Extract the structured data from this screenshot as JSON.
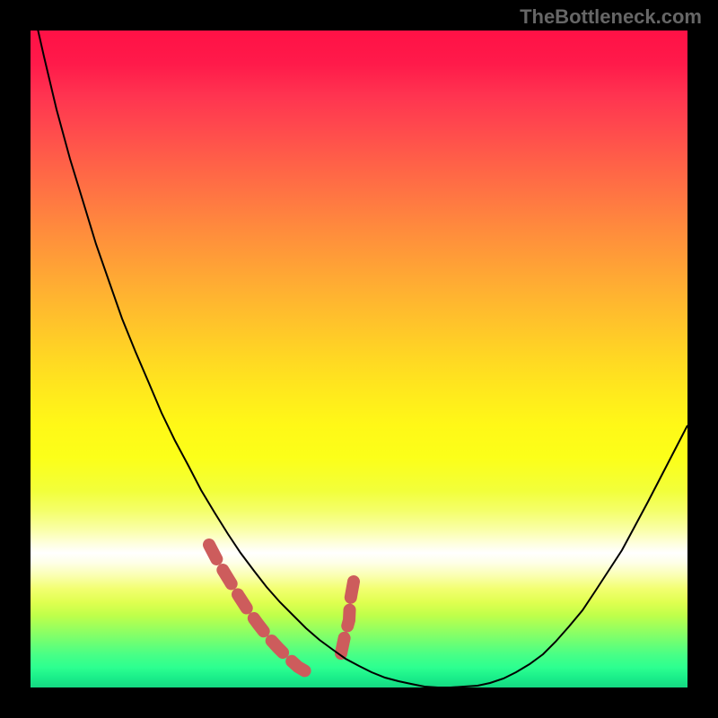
{
  "watermark": "TheBottleneck.com",
  "chart_data": {
    "type": "line",
    "title": "",
    "xlabel": "",
    "ylabel": "",
    "x": [
      0.0,
      0.02,
      0.04,
      0.06,
      0.08,
      0.1,
      0.12,
      0.14,
      0.16,
      0.18,
      0.2,
      0.22,
      0.24,
      0.26,
      0.28,
      0.3,
      0.32,
      0.34,
      0.36,
      0.38,
      0.4,
      0.42,
      0.44,
      0.46,
      0.48,
      0.5,
      0.52,
      0.54,
      0.56,
      0.58,
      0.6,
      0.62,
      0.64,
      0.66,
      0.68,
      0.7,
      0.72,
      0.74,
      0.76,
      0.78,
      0.8,
      0.82,
      0.84,
      0.86,
      0.88,
      0.9,
      0.92,
      0.94,
      0.96,
      0.98,
      1.0
    ],
    "values": [
      1.05,
      0.96,
      0.88,
      0.805,
      0.738,
      0.675,
      0.617,
      0.562,
      0.511,
      0.463,
      0.418,
      0.376,
      0.337,
      0.3,
      0.266,
      0.234,
      0.205,
      0.178,
      0.153,
      0.13,
      0.109,
      0.09,
      0.073,
      0.057,
      0.044,
      0.033,
      0.023,
      0.015,
      0.009,
      0.005,
      0.002,
      0.0,
      0.0,
      0.001,
      0.003,
      0.007,
      0.014,
      0.023,
      0.035,
      0.051,
      0.07,
      0.092,
      0.118,
      0.146,
      0.177,
      0.21,
      0.245,
      0.282,
      0.32,
      0.359,
      0.399
    ],
    "xlim": [
      0,
      1
    ],
    "ylim": [
      0,
      1
    ],
    "highlight_x_ranges": [
      [
        0.28,
        0.36
      ],
      [
        0.42,
        0.48
      ]
    ],
    "background_gradient": "thermal (red-yellow-white-green)"
  }
}
